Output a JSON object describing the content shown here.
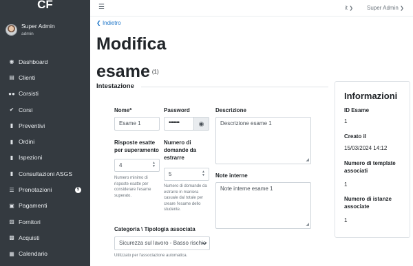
{
  "brand": "CF",
  "user": {
    "name": "Super Admin",
    "role": "admin"
  },
  "menu": [
    {
      "label": "Dashboard",
      "icon": "palette-icon"
    },
    {
      "label": "Clienti",
      "icon": "address-card-icon"
    },
    {
      "label": "Corsisti",
      "icon": "users-icon"
    },
    {
      "label": "Corsi",
      "icon": "check-circle-icon"
    },
    {
      "label": "Preventivi",
      "icon": "file-icon"
    },
    {
      "label": "Ordini",
      "icon": "file-icon"
    },
    {
      "label": "Ispezioni",
      "icon": "file-icon"
    },
    {
      "label": "Consultazioni ASGS",
      "icon": "file-icon"
    },
    {
      "label": "Prenotazioni",
      "icon": "list-icon",
      "badge": "5"
    },
    {
      "label": "Pagamenti",
      "icon": "wallet-icon"
    },
    {
      "label": "Fornitori",
      "icon": "truck-icon"
    },
    {
      "label": "Acquisti",
      "icon": "money-icon"
    },
    {
      "label": "Calendario",
      "icon": "calendar-icon"
    }
  ],
  "topbar": {
    "menu_icon": "hamburger-icon",
    "lang": "it",
    "user": "Super Admin"
  },
  "back_label": "Indietro",
  "page": {
    "title": "Modifica esame",
    "id_label": "(1)"
  },
  "section_title": "Intestazione",
  "form": {
    "nome": {
      "label": "Nome*",
      "value": "Esame 1"
    },
    "password": {
      "label": "Password",
      "value": "•••••••"
    },
    "descrizione": {
      "label": "Descrizione",
      "value": "Descrizione esame 1"
    },
    "risposte": {
      "label": "Risposte esatte per superamento",
      "value": "4",
      "help": "Numero minimo di risposte esatte per considerare l'esame superato."
    },
    "domande": {
      "label": "Numero di domande da estrarre",
      "value": "5",
      "help": "Numero di domande da estrarre in maniera casuale dal totale per creare l'esame dello studente."
    },
    "note": {
      "label": "Note interne",
      "value": "Note interne esame 1"
    },
    "categoria": {
      "label": "Categoria \\ Tipologia associata",
      "value": "Sicurezza sul lavoro - Basso rischio",
      "help": "Utilizzato per l'associazione automatica."
    }
  },
  "info": {
    "title": "Informazioni",
    "id_label": "ID Esame",
    "id_value": "1",
    "created_label": "Creato il",
    "created_value": "15/03/2024 14:12",
    "templates_label": "Numero di template associati",
    "templates_value": "1",
    "instances_label": "Numero di istanze associate",
    "instances_value": "1"
  }
}
